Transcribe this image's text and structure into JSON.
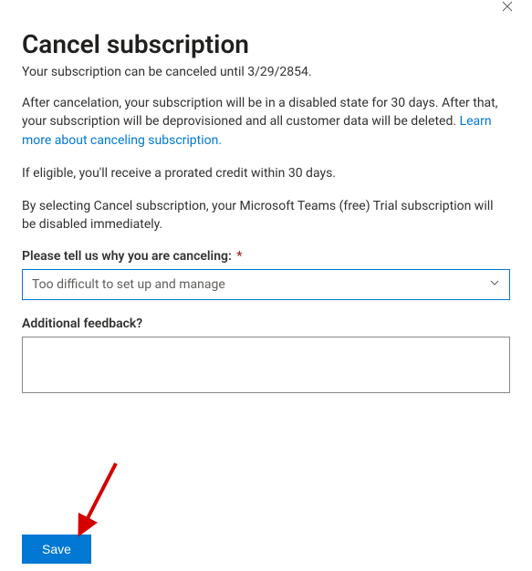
{
  "header": {
    "title": "Cancel subscription",
    "subtitle": "Your subscription can be canceled until 3/29/2854."
  },
  "paragraphs": {
    "p1": "After cancelation, your subscription will be in a disabled state for 30 days. After that, your subscription will be deprovisioned and all customer data will be deleted. ",
    "learn_link": "Learn more about canceling subscription.",
    "p2": "If eligible, you'll receive a prorated credit within 30 days.",
    "p3": "By selecting Cancel subscription, your Microsoft Teams (free) Trial subscription will be disabled immediately."
  },
  "reason": {
    "label": "Please tell us why you are canceling:",
    "required_mark": "*",
    "selected": "Too difficult to set up and manage"
  },
  "feedback": {
    "label": "Additional feedback?",
    "value": ""
  },
  "footer": {
    "save_label": "Save"
  }
}
